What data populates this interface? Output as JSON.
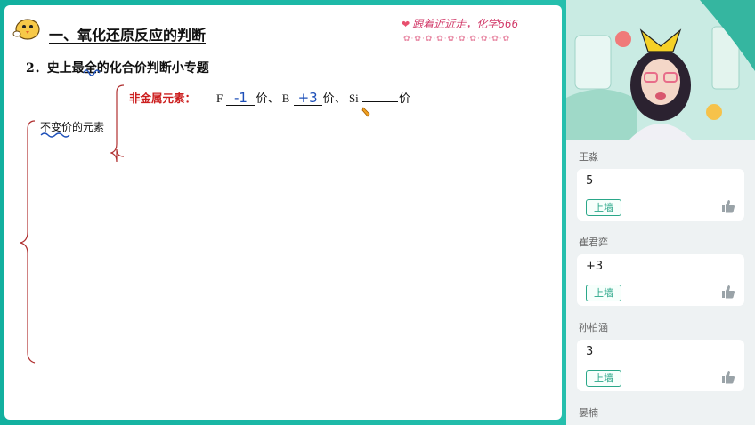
{
  "slide": {
    "section_title": "一、氧化还原反应的判断",
    "slogan": "跟着近近走，化学666",
    "subtitle": "2．史上最全的化合价判断小专题",
    "nonmetal": {
      "label": "非金属元素：",
      "items": [
        {
          "element": "F",
          "answer": "-1",
          "suffix": "价、"
        },
        {
          "element": "B",
          "answer": "+3",
          "suffix": "价、"
        },
        {
          "element": "Si",
          "answer": "",
          "suffix": "价"
        }
      ]
    },
    "invariable_label": "不变价的元素"
  },
  "chat": {
    "messages": [
      {
        "name": "王淼",
        "text": "5",
        "button": "上墙"
      },
      {
        "name": "崔君弈",
        "text": "+3",
        "button": "上墙"
      },
      {
        "name": "孙柏涵",
        "text": "3",
        "button": "上墙"
      },
      {
        "name": "晏楠",
        "text": "",
        "button": ""
      }
    ]
  },
  "colors": {
    "frame": "#1fb6a6",
    "nonmetal_label": "#cc1f1f",
    "handwriting": "#1d4fb8",
    "wall_button": "#2aa789"
  }
}
